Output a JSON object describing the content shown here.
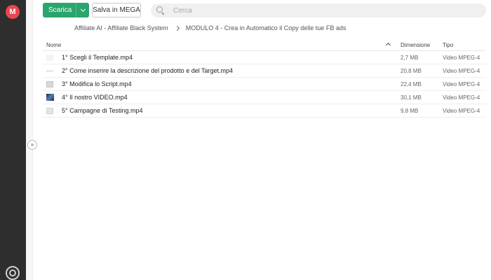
{
  "toolbar": {
    "download_label": "Scarica",
    "save_label": "Salva in MEGA"
  },
  "search": {
    "placeholder": "Cerca"
  },
  "breadcrumb": [
    "Affiliate AI - Affiliate Black System",
    "MODULO 4 - Crea in Automatico il Copy delle tue FB ads"
  ],
  "table": {
    "headers": {
      "name": "Nome",
      "size": "Dimensione",
      "type": "Tipo"
    },
    "rows": [
      {
        "name": "1° Scegli il Template.mp4",
        "size": "2,7 MB",
        "type": "Video MPEG-4"
      },
      {
        "name": "2° Come inserire la descrizione del prodotto e del Target.mp4",
        "size": "20,8 MB",
        "type": "Video MPEG-4"
      },
      {
        "name": "3° Modifica lo Script.mp4",
        "size": "22,4 MB",
        "type": "Video MPEG-4"
      },
      {
        "name": "4° Il nostro VIDEO.mp4",
        "size": "30,1 MB",
        "type": "Video MPEG-4"
      },
      {
        "name": "5° Campagne di Testing.mp4",
        "size": "9,8 MB",
        "type": "Video MPEG-4"
      }
    ]
  },
  "brand": {
    "logo_letter": "M",
    "accent": "#e9464e",
    "download_green": "#2ba56d"
  },
  "icons": {
    "logo": "mega-logo-icon",
    "search": "search-icon",
    "caret": "chevron-down-icon",
    "expand": "double-chevron-right-icon",
    "sort": "sort-ascending-icon",
    "rail_bottom": "transfer-manager-icon"
  }
}
